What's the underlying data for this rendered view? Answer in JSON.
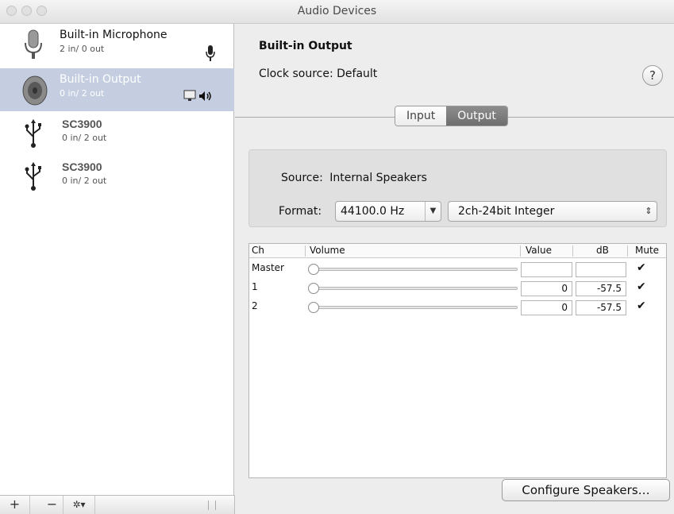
{
  "window": {
    "title": "Audio Devices"
  },
  "devices": [
    {
      "name": "Built-in Microphone",
      "io": "2 in/ 0 out"
    },
    {
      "name": "Built-in Output",
      "io": "0 in/ 2 out"
    },
    {
      "name": "SC3900",
      "io": "0 in/ 2 out"
    },
    {
      "name": "SC3900",
      "io": "0 in/ 2 out"
    }
  ],
  "sidebar_toolbar": {
    "add": "+",
    "remove": "−",
    "gear": "✲▾"
  },
  "detail": {
    "device_title": "Built-in Output",
    "clock_source": "Clock source: Default",
    "help": "?",
    "tabs": [
      "Input",
      "Output"
    ],
    "source_label": "Source:",
    "source_value": "Internal Speakers",
    "format_label": "Format:",
    "sample_rate": "44100.0 Hz",
    "bit_format": "2ch-24bit Integer",
    "table": {
      "headers": [
        "Ch",
        "Volume",
        "Value",
        "dB",
        "Mute"
      ],
      "rows": [
        {
          "ch": "Master",
          "value": "",
          "db": "",
          "muted": true
        },
        {
          "ch": "1",
          "value": "0",
          "db": "-57.5",
          "muted": true
        },
        {
          "ch": "2",
          "value": "0",
          "db": "-57.5",
          "muted": true
        }
      ]
    },
    "configure_button": "Configure Speakers…"
  },
  "colors": {
    "selection": "#c5cee0",
    "active_tab": "#7a7a7a"
  },
  "icons": [
    "microphone-icon",
    "speaker-icon",
    "usb-icon",
    "monitor-icon",
    "volume-icon",
    "gear-icon",
    "help-icon",
    "checkmark-icon"
  ]
}
